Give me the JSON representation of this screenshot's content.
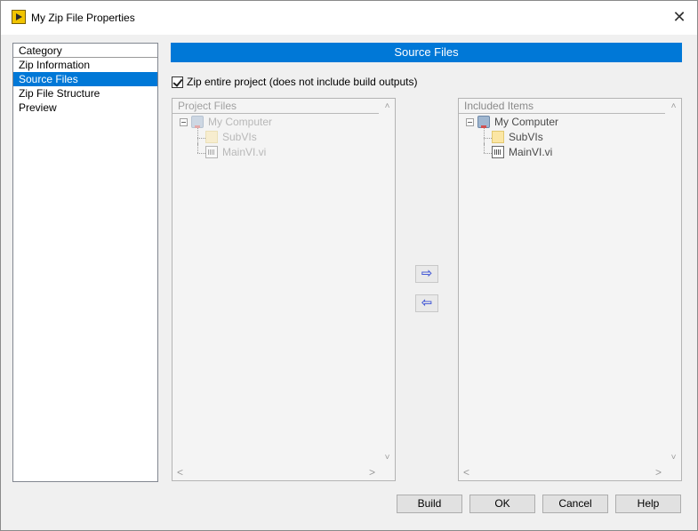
{
  "window": {
    "title": "My Zip File Properties",
    "close_glyph": "✕"
  },
  "category": {
    "header": "Category",
    "items": [
      {
        "label": "Zip Information",
        "selected": false
      },
      {
        "label": "Source Files",
        "selected": true
      },
      {
        "label": "Zip File Structure",
        "selected": false
      },
      {
        "label": "Preview",
        "selected": false
      }
    ]
  },
  "section": {
    "title": "Source Files"
  },
  "options": {
    "zip_entire_project_label": "Zip entire project (does not include build outputs)",
    "zip_entire_project_checked": true
  },
  "project_files": {
    "header": "Project Files",
    "root": "My Computer",
    "children": [
      "SubVIs",
      "MainVI.vi"
    ],
    "enabled": false
  },
  "included_items": {
    "header": "Included Items",
    "root": "My Computer",
    "children": [
      "SubVIs",
      "MainVI.vi"
    ]
  },
  "move_buttons": {
    "add_glyph": "⇨",
    "remove_glyph": "⇦"
  },
  "scroll_glyphs": {
    "up": "˄",
    "down": "˅",
    "left": "<",
    "right": ">"
  },
  "buttons": {
    "build": "Build",
    "ok": "OK",
    "cancel": "Cancel",
    "help": "Help"
  },
  "colors": {
    "accent": "#0078d7",
    "window_bg": "#f0f0f0",
    "disabled_text": "#b8b8b8"
  }
}
